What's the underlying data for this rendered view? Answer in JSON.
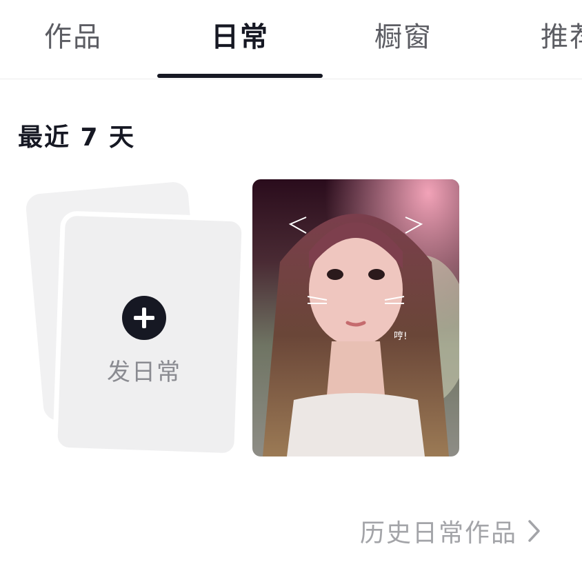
{
  "tabs": [
    {
      "label": "作品",
      "active": false
    },
    {
      "label": "日常",
      "active": true
    },
    {
      "label": "橱窗",
      "active": false
    },
    {
      "label": "推荐",
      "active": false
    }
  ],
  "section": {
    "title": "最近 7 天"
  },
  "add_card": {
    "label": "发日常",
    "icon": "plus-icon"
  },
  "daily_post": {
    "sticker_text": "哼!"
  },
  "history_link": {
    "label": "历史日常作品",
    "icon": "chevron-right-icon"
  },
  "colors": {
    "text_primary": "#161823",
    "text_secondary": "#5c5d63",
    "text_muted": "#a3a4a8",
    "card_bg": "#efeff0",
    "indicator": "#161823"
  }
}
